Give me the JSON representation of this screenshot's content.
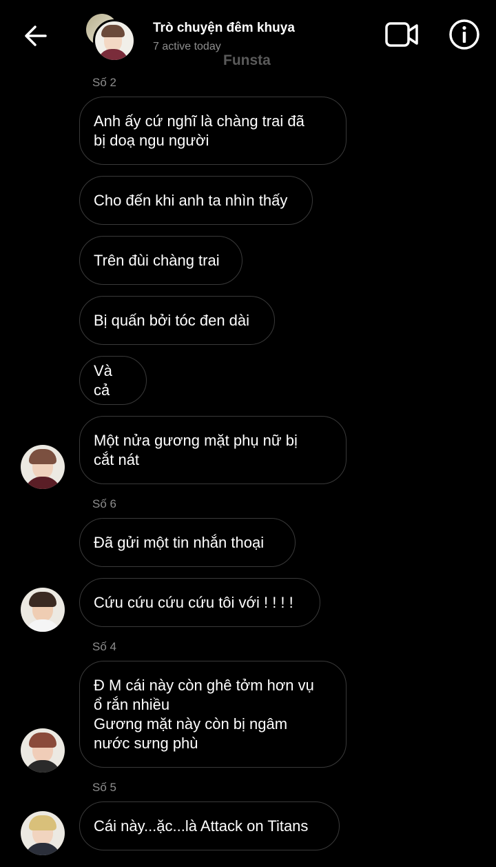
{
  "header": {
    "title": "Trò chuyện đêm khuya",
    "subtitle": "7 active today",
    "watermark": "Funsta"
  },
  "messages": [
    {
      "sender": "Số 2",
      "text": "Anh ấy cứ nghĩ là chàng trai đã\nbị doạ ngu người"
    },
    {
      "text": "Cho đến khi anh ta nhìn thấy"
    },
    {
      "text": "Trên đùi chàng trai"
    },
    {
      "text": "Bị quấn bởi tóc đen dài"
    },
    {
      "text": "Và cả"
    },
    {
      "text": "Một nửa gương mặt phụ nữ bị\ncắt nát"
    },
    {
      "sender": "Số 6",
      "text": "Đã gửi một tin nhắn thoại"
    },
    {
      "text": "Cứu cứu cứu cứu tôi với ! ! ! !"
    },
    {
      "sender": "Số 4",
      "text": "Đ M cái này còn ghê tởm hơn vụ\nổ rắn nhiều\nGương mặt này còn bị ngâm\nnước sưng phù"
    },
    {
      "sender": "Số 5",
      "text": "Cái này...ặc...là Attack on Titans"
    }
  ],
  "icons": {
    "back": "arrow-left-icon",
    "video": "video-camera-icon",
    "info": "info-circle-icon"
  },
  "colors": {
    "background": "#000000",
    "bubble_border": "#3a3a3a",
    "secondary_text": "#8e8e8e"
  }
}
